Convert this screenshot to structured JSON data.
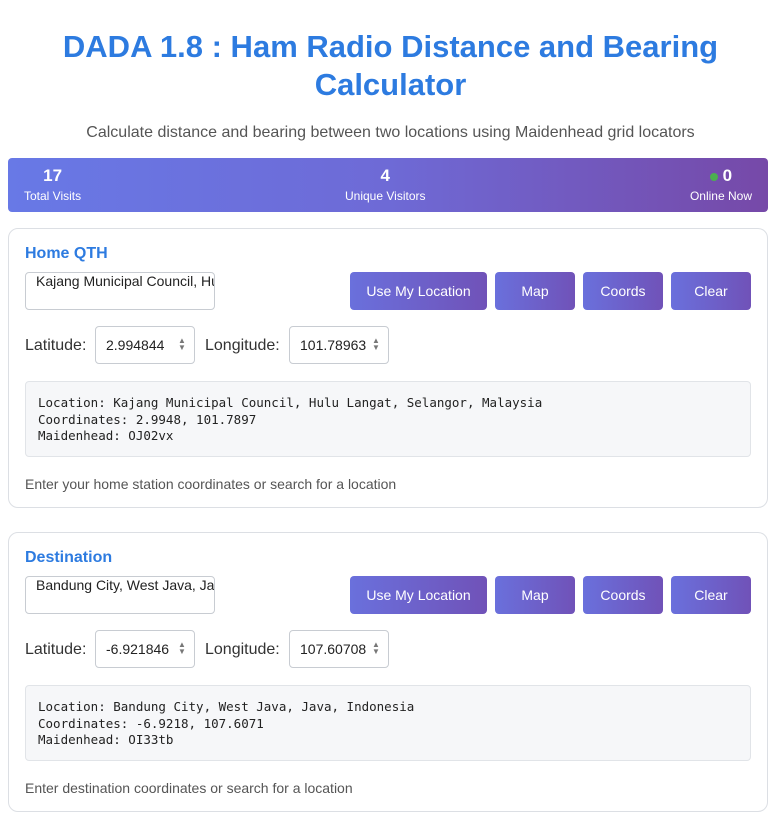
{
  "header": {
    "title": "DADA 1.8 : Ham Radio Distance and Bearing Calculator",
    "subtitle": "Calculate distance and bearing between two locations using Maidenhead grid locators"
  },
  "stats": {
    "total_visits": {
      "value": "17",
      "label": "Total Visits"
    },
    "unique_visitors": {
      "value": "4",
      "label": "Unique Visitors"
    },
    "online_now": {
      "value": "0",
      "label": "Online Now"
    },
    "online_dot_color": "#4caf50"
  },
  "home": {
    "title": "Home QTH",
    "search_value": "Kajang Municipal Council, Hulu Langat, Selangor, Malaysia",
    "buttons": {
      "use_location": "Use My Location",
      "map": "Map",
      "coords": "Coords",
      "clear": "Clear"
    },
    "latitude_label": "Latitude:",
    "latitude_value": "2.994844",
    "longitude_label": "Longitude:",
    "longitude_value": "101.78963",
    "info": {
      "location": "Location: Kajang Municipal Council, Hulu Langat, Selangor, Malaysia",
      "coordinates": "Coordinates: 2.9948, 101.7897",
      "maidenhead": "Maidenhead: OJ02vx"
    },
    "hint": "Enter your home station coordinates or search for a location"
  },
  "destination": {
    "title": "Destination",
    "search_value": "Bandung City, West Java, Java, Indonesia",
    "buttons": {
      "use_location": "Use My Location",
      "map": "Map",
      "coords": "Coords",
      "clear": "Clear"
    },
    "latitude_label": "Latitude:",
    "latitude_value": "-6.921846",
    "longitude_label": "Longitude:",
    "longitude_value": "107.60708",
    "info": {
      "location": "Location: Bandung City, West Java, Java, Indonesia",
      "coordinates": "Coordinates: -6.9218, 107.6071",
      "maidenhead": "Maidenhead: OI33tb"
    },
    "hint": "Enter destination coordinates or search for a location"
  },
  "colors": {
    "title": "#2d7be0",
    "accent_gradient_start": "#6a70dc",
    "accent_gradient_end": "#7052b8"
  }
}
